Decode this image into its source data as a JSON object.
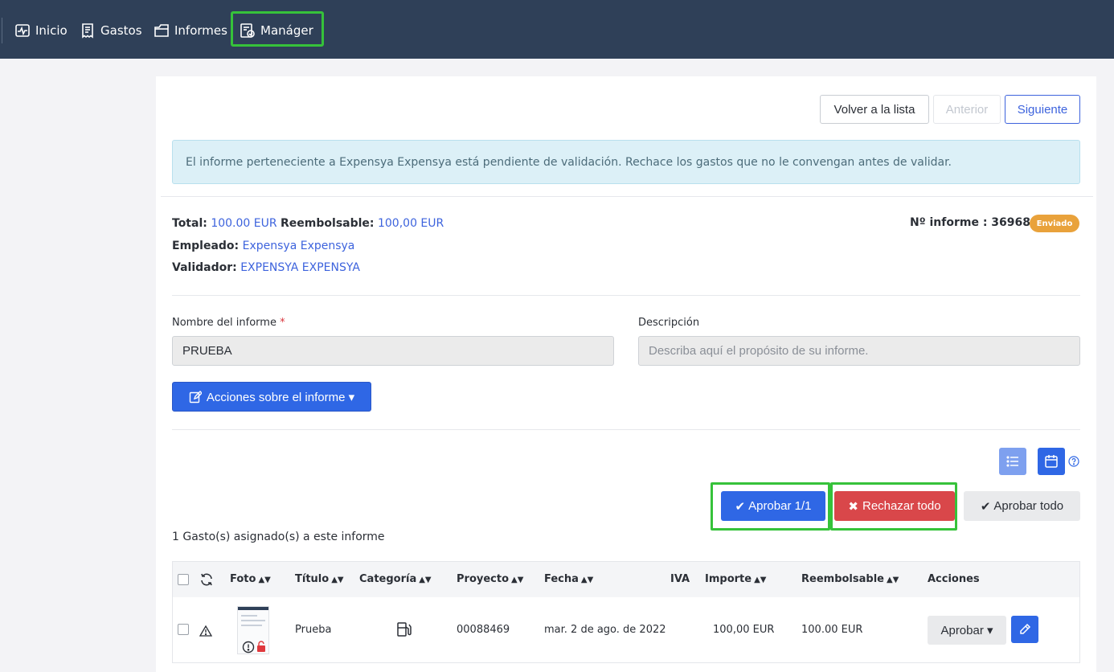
{
  "nav": {
    "items": [
      {
        "label": "Inicio",
        "icon": "activity-icon"
      },
      {
        "label": "Gastos",
        "icon": "receipt-icon"
      },
      {
        "label": "Informes",
        "icon": "folder-icon"
      },
      {
        "label": "Manáger",
        "icon": "manager-check-icon"
      }
    ]
  },
  "toolbar": {
    "back_label": "Volver a la lista",
    "prev_label": "Anterior",
    "next_label": "Siguiente"
  },
  "alert": {
    "text": "El informe perteneciente a Expensya Expensya está pendiente de validación. Rechace los gastos que no le convengan antes de validar."
  },
  "summary": {
    "total_label": "Total:",
    "total_value": "100.00 EUR",
    "reimbursable_label": "Reembolsable:",
    "reimbursable_value": "100,00 EUR",
    "employee_label": "Empleado:",
    "employee_value": "Expensya Expensya",
    "validator_label": "Validador:",
    "validator_value": "EXPENSYA EXPENSYA",
    "report_number": "Nº informe : 36968",
    "status_badge": "Enviado"
  },
  "form": {
    "name_label": "Nombre del informe",
    "name_required": "*",
    "name_value": "PRUEBA",
    "description_label": "Descripción",
    "description_placeholder": "Describa aquí el propósito de su informe."
  },
  "actions": {
    "report_actions_label": "Acciones sobre el informe ▾",
    "approve_label": "Aprobar 1/1",
    "reject_label": "Rechazar todo",
    "approve_all_label": "Aprobar todo"
  },
  "expenses": {
    "count_text": "1 Gasto(s) asignado(s) a este informe",
    "columns": [
      "Foto",
      "Título",
      "Categoría",
      "Proyecto",
      "Fecha",
      "IVA",
      "Importe",
      "Reembolsable",
      "Acciones"
    ],
    "rows": [
      {
        "title": "Prueba",
        "category_icon": "fuel-pump-icon",
        "project": "00088469",
        "date": "mar. 2 de ago. de 2022",
        "vat": "",
        "amount": "100,00 EUR",
        "reimbursable": "100.00 EUR",
        "action_label": "Aprobar ▾"
      }
    ]
  },
  "colors": {
    "nav_bg": "#2f4058",
    "primary": "#2f67e5",
    "danger": "#d9474a",
    "badge": "#e9a23b",
    "highlight": "#36c23a",
    "alert_bg": "#dcf0f7"
  }
}
